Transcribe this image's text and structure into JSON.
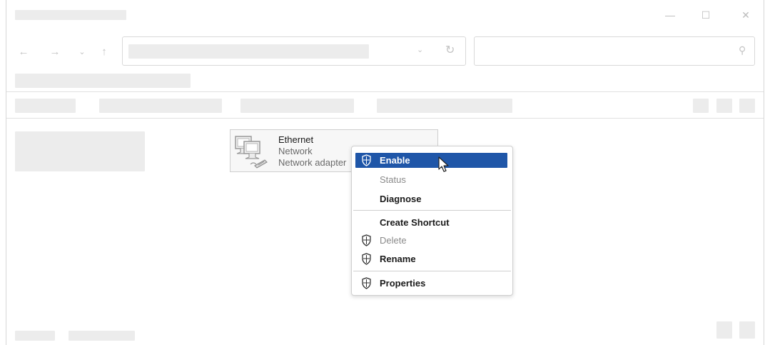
{
  "window_controls": {
    "minimize": "—",
    "maximize": "☐",
    "close": "✕"
  },
  "nav": {
    "back": "←",
    "forward": "→",
    "recent": "⌄",
    "up": "↑"
  },
  "address": {
    "dropdown": "⌄",
    "refresh": "↻"
  },
  "search": {
    "icon": "⚲"
  },
  "adapter": {
    "name": "Ethernet",
    "status": "Network",
    "device": "Network adapter",
    "icon": "network-computers-icon"
  },
  "context_menu": {
    "items": [
      {
        "label": "Enable",
        "shield": true,
        "state": "highlighted"
      },
      {
        "label": "Status",
        "shield": false,
        "state": "disabled"
      },
      {
        "label": "Diagnose",
        "shield": false,
        "state": "normal"
      },
      {
        "label": "Create Shortcut",
        "shield": false,
        "state": "normal"
      },
      {
        "label": "Delete",
        "shield": true,
        "state": "disabled"
      },
      {
        "label": "Rename",
        "shield": true,
        "state": "normal"
      },
      {
        "label": "Properties",
        "shield": true,
        "state": "normal"
      }
    ],
    "highlight_color": "#1f56a8"
  },
  "colors": {
    "placeholder": "#ececec",
    "border": "#d9d9d9",
    "accent": "#1f56a8"
  }
}
